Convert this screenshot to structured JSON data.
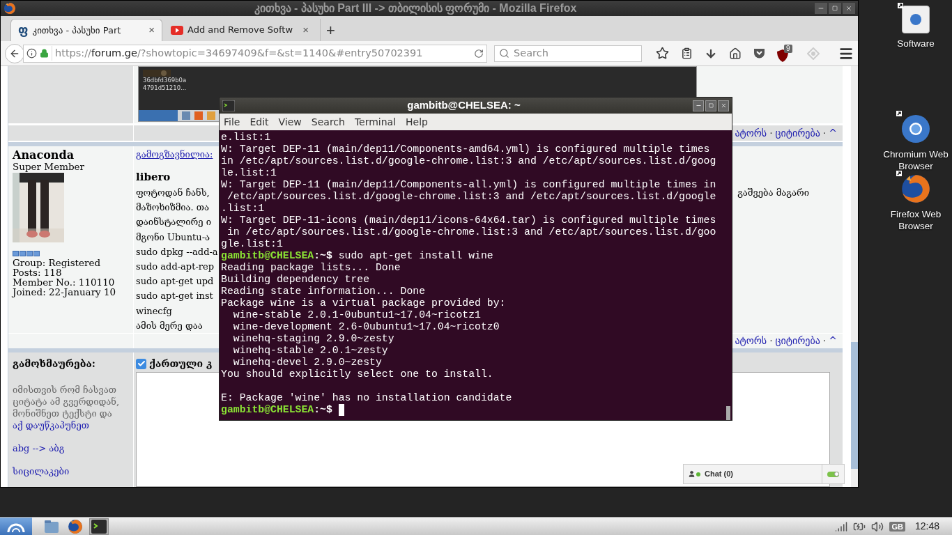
{
  "desktop_icons": [
    {
      "kind": "software",
      "label": "Software"
    },
    {
      "kind": "chromium",
      "label": "Chromium Web Browser"
    },
    {
      "kind": "firefox",
      "label": "Firefox Web Browser"
    }
  ],
  "browser": {
    "title": "კითხვა - პასუხი Part III -> თბილისის ფორუმი - Mozilla Firefox",
    "tabs": [
      {
        "kind": "forum",
        "icon": "ფ",
        "label": "კითხვა - პასუხი Part",
        "close": "×",
        "selected": true
      },
      {
        "kind": "video",
        "label": "Add and Remove Softw",
        "close": "×",
        "selected": false
      }
    ],
    "new_tab": "+",
    "url": {
      "scheme": "https://",
      "host": "forum.ge",
      "path": "/?showtopic=34697409&f=&st=1140&#entry50702391"
    },
    "search": {
      "placeholder": "Search"
    },
    "blocker_badge": "9"
  },
  "forum": {
    "thumbnail_caption": [
      "36dbfd369b0a",
      "4791d51210..."
    ],
    "top_links": {
      "items": [
        "ატორს",
        "ციტირება",
        "^"
      ],
      "separator": "·"
    },
    "author": {
      "name": "Anaconda",
      "rank": "Super Member",
      "details": [
        "Group: Registered",
        "Posts: 118",
        "Member No.: 110110",
        "Joined: 22-January 10"
      ]
    },
    "posted_label": "გამოგზავნილია:",
    "post_title": "libero",
    "lines": [
      {
        "start": "ფოტოდან ჩანს,",
        "end": "გაშვება მაგარი"
      },
      {
        "start": "მაზოხიზმია. თა"
      },
      {
        "start": "დაინსტალირე ი"
      },
      {
        "start": "მგონი Ubuntu-ა"
      },
      {
        "start": "sudo dpkg --add-a"
      },
      {
        "start": "sudo add-apt-rep"
      },
      {
        "start": "sudo apt-get upd"
      },
      {
        "start": "sudo apt-get inst"
      },
      {
        "start": "winecfg"
      },
      {
        "start": "ამის მერე დაა"
      }
    ],
    "bottom_links": {
      "items": [
        "ატორს",
        "ციტირება",
        "^"
      ],
      "separator": "·"
    },
    "reply": {
      "title": "გამოხმაურება:",
      "hint": "იმისთვის რომ ჩასვათ ციტატა ამ გვერდიდან, მონიშნეთ ტექსტი და",
      "hint_link": "აქ დაუწკაპუნეთ",
      "links": [
        "abg --> აბგ",
        "სიცილაკები"
      ],
      "keyboard_option": {
        "label": "ქართული კ",
        "checked": true
      }
    }
  },
  "chat": {
    "label": "Chat (0)",
    "enabled": true
  },
  "terminal": {
    "title": "gambitb@CHELSEA: ~",
    "menu": [
      "File",
      "Edit",
      "View",
      "Search",
      "Terminal",
      "Help"
    ],
    "lines": [
      {
        "kind": "out",
        "text": "e.list:1"
      },
      {
        "kind": "out",
        "text": "W: Target DEP-11 (main/dep11/Components-amd64.yml) is configured multiple times"
      },
      {
        "kind": "out",
        "text": "in /etc/apt/sources.list.d/google-chrome.list:3 and /etc/apt/sources.list.d/goog"
      },
      {
        "kind": "out",
        "text": "le.list:1"
      },
      {
        "kind": "out",
        "text": "W: Target DEP-11 (main/dep11/Components-all.yml) is configured multiple times in"
      },
      {
        "kind": "out",
        "text": " /etc/apt/sources.list.d/google-chrome.list:3 and /etc/apt/sources.list.d/google"
      },
      {
        "kind": "out",
        "text": ".list:1"
      },
      {
        "kind": "out",
        "text": "W: Target DEP-11-icons (main/dep11/icons-64x64.tar) is configured multiple times"
      },
      {
        "kind": "out",
        "text": " in /etc/apt/sources.list.d/google-chrome.list:3 and /etc/apt/sources.list.d/goo"
      },
      {
        "kind": "out",
        "text": "gle.list:1"
      },
      {
        "kind": "prompt",
        "user": "gambitb@CHELSEA",
        "path": ":~$",
        "command": "sudo apt-get install wine"
      },
      {
        "kind": "out",
        "text": "Reading package lists... Done"
      },
      {
        "kind": "out",
        "text": "Building dependency tree"
      },
      {
        "kind": "out",
        "text": "Reading state information... Done"
      },
      {
        "kind": "out",
        "text": "Package wine is a virtual package provided by:"
      },
      {
        "kind": "out",
        "text": "  wine-stable 2.0.1-0ubuntu1~17.04~ricotz1"
      },
      {
        "kind": "out",
        "text": "  wine-development 2.6-0ubuntu1~17.04~ricotz0"
      },
      {
        "kind": "out",
        "text": "  winehq-staging 2.9.0~zesty"
      },
      {
        "kind": "out",
        "text": "  winehq-stable 2.0.1~zesty"
      },
      {
        "kind": "out",
        "text": "  winehq-devel 2.9.0~zesty"
      },
      {
        "kind": "out",
        "text": "You should explicitly select one to install."
      },
      {
        "kind": "blank"
      },
      {
        "kind": "out",
        "text": "E: Package 'wine' has no installation candidate"
      },
      {
        "kind": "prompt",
        "user": "gambitb@CHELSEA",
        "path": ":~$",
        "cursor": true
      }
    ]
  },
  "taskbar": {
    "items": [
      {
        "kind": "files",
        "selected": false
      },
      {
        "kind": "firefox",
        "selected": false
      },
      {
        "kind": "terminal",
        "selected": true
      }
    ],
    "keyboard": "GB",
    "clock": "12:48"
  }
}
